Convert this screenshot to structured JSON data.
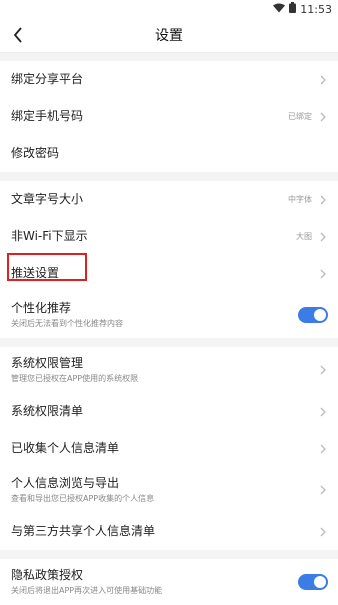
{
  "status_bar": {
    "time": "11:53",
    "icons": [
      "wifi-icon",
      "battery-icon"
    ]
  },
  "header": {
    "title": "设置",
    "back_icon": "chevron-left-icon"
  },
  "groups": [
    {
      "items": [
        {
          "label": "绑定分享平台",
          "value": ""
        },
        {
          "label": "绑定手机号码",
          "value": "已绑定"
        },
        {
          "label": "修改密码",
          "value": ""
        }
      ]
    },
    {
      "items": [
        {
          "label": "文章字号大小",
          "value": "中字体"
        },
        {
          "label": "非Wi-Fi下显示",
          "value": "大图"
        },
        {
          "label": "推送设置",
          "value": ""
        },
        {
          "label": "个性化推荐",
          "sub": "关闭后无法看到个性化推荐内容",
          "toggle": true
        }
      ]
    },
    {
      "items": [
        {
          "label": "系统权限管理",
          "sub": "管理您已授权在APP使用的系统权限"
        },
        {
          "label": "系统权限清单"
        },
        {
          "label": "已收集个人信息清单"
        },
        {
          "label": "个人信息浏览与导出",
          "sub": "查看和导出您已授权APP收集的个人信息"
        },
        {
          "label": "与第三方共享个人信息清单"
        }
      ]
    },
    {
      "items": [
        {
          "label": "隐私政策授权",
          "sub": "关闭后将退出APP再次进入可使用基础功能",
          "toggle": true
        }
      ]
    }
  ],
  "colors": {
    "accent": "#3b7ce6",
    "highlight": "#e02020"
  }
}
